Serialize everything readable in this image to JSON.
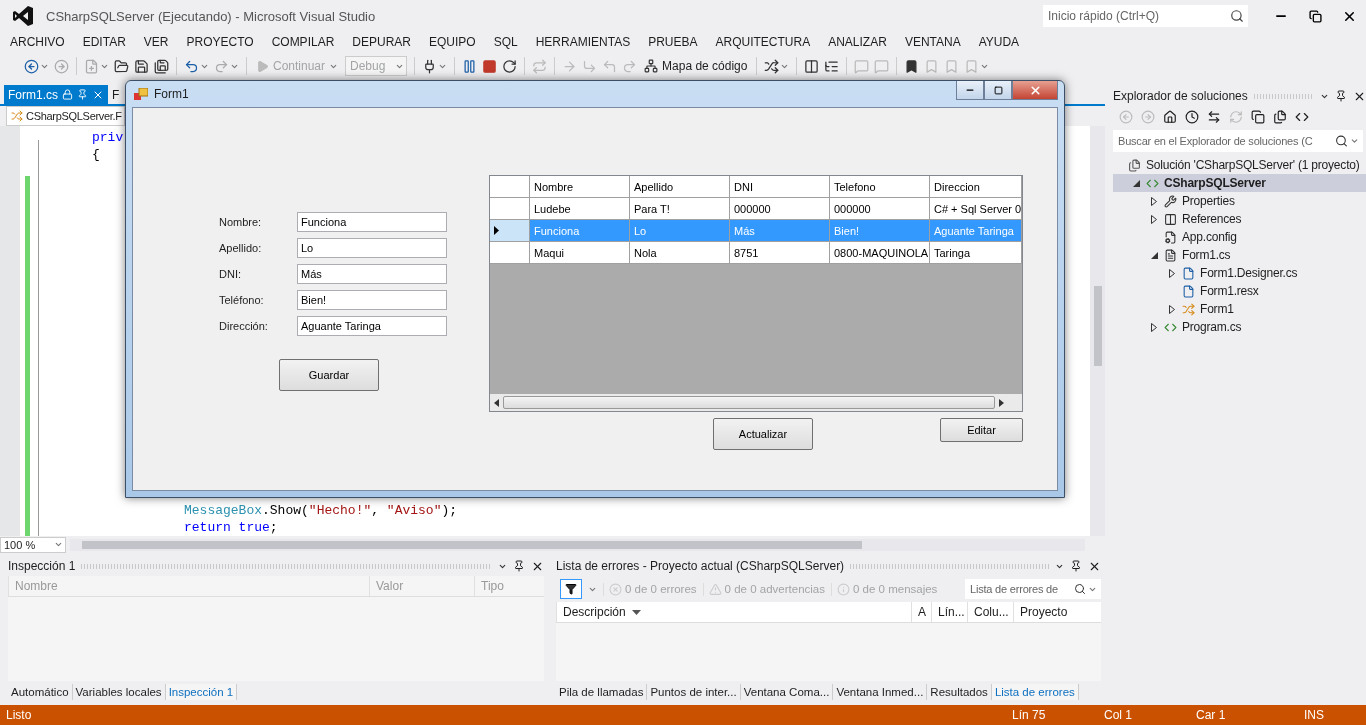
{
  "window": {
    "title": "CSharpSQLServer (Ejecutando) - Microsoft Visual Studio"
  },
  "quick_launch": {
    "placeholder": "Inicio rápido (Ctrl+Q)"
  },
  "menu": [
    "ARCHIVO",
    "EDITAR",
    "VER",
    "PROYECTO",
    "COMPILAR",
    "DEPURAR",
    "EQUIPO",
    "SQL",
    "HERRAMIENTAS",
    "PRUEBA",
    "ARQUITECTURA",
    "ANALIZAR",
    "VENTANA",
    "AYUDA"
  ],
  "toolbar": {
    "continue": {
      "label": "Continuar",
      "disabled": true
    },
    "configuration": {
      "value": "Debug",
      "disabled": true
    },
    "code_map": {
      "label": "Mapa de código"
    }
  },
  "editor": {
    "tabs": [
      {
        "label": "Form1.cs",
        "selected": true
      },
      {
        "label": "F",
        "selected": false
      }
    ],
    "navigation": "CSharpSQLServer.F",
    "code_top": [
      [
        {
          "text": "priv",
          "kind": "keyword"
        }
      ],
      [
        {
          "text": "{",
          "kind": "plain"
        }
      ]
    ],
    "code_bottom": [
      [
        {
          "text": "MessageBox",
          "kind": "type"
        },
        {
          "text": ".Show(",
          "kind": "plain"
        },
        {
          "text": "\"Hecho!\"",
          "kind": "string"
        },
        {
          "text": ", ",
          "kind": "plain"
        },
        {
          "text": "\"Aviso\"",
          "kind": "string"
        },
        {
          "text": ");",
          "kind": "plain"
        }
      ],
      [
        {
          "text": "return true",
          "kind": "keyword"
        },
        {
          "text": ";",
          "kind": "plain"
        }
      ]
    ],
    "zoom": "100 %"
  },
  "form": {
    "title": "Form1",
    "fields": [
      {
        "label": "Nombre:",
        "value": "Funciona"
      },
      {
        "label": "Apellido:",
        "value": "Lo"
      },
      {
        "label": "DNI:",
        "value": "Más"
      },
      {
        "label": "Teléfono:",
        "value": "Bien!"
      },
      {
        "label": "Dirección:",
        "value": "Aguante Taringa"
      }
    ],
    "save_button": "Guardar",
    "grid": {
      "columns": [
        "Nombre",
        "Apellido",
        "DNI",
        "Telefono",
        "Direccion"
      ],
      "rows": [
        {
          "selected": false,
          "cells": [
            "Ludebe",
            "Para T!",
            "000000",
            "000000",
            "C# + Sql Server 0"
          ]
        },
        {
          "selected": true,
          "cells": [
            "Funciona",
            "Lo",
            "Más",
            "Bien!",
            "Aguante Taringa"
          ]
        },
        {
          "selected": false,
          "cells": [
            "Maqui",
            "Nola",
            "8751",
            "0800-MAQUINOLA",
            "Taringa"
          ]
        }
      ]
    },
    "refresh_button": "Actualizar",
    "edit_button": "Editar"
  },
  "solution_explorer": {
    "title": "Explorador de soluciones",
    "search": {
      "placeholder": "Buscar en el Explorador de soluciones (C"
    },
    "tree": [
      {
        "label": "Solución 'CSharpSQLServer'  (1 proyecto)",
        "kind": "solution",
        "selected": false,
        "children": [
          {
            "label": "CSharpSQLServer",
            "kind": "project",
            "expanded": true,
            "selected": true,
            "children": [
              {
                "label": "Properties",
                "kind": "properties",
                "expanded": false,
                "selected": false
              },
              {
                "label": "References",
                "kind": "references",
                "expanded": false,
                "selected": false
              },
              {
                "label": "App.config",
                "kind": "config",
                "selected": false
              },
              {
                "label": "Form1.cs",
                "kind": "form",
                "expanded": true,
                "selected": false,
                "children": [
                  {
                    "label": "Form1.Designer.cs",
                    "kind": "file",
                    "expanded": false,
                    "selected": false
                  },
                  {
                    "label": "Form1.resx",
                    "kind": "file",
                    "selected": false
                  },
                  {
                    "label": "Form1",
                    "kind": "class",
                    "expanded": false,
                    "selected": false
                  }
                ]
              },
              {
                "label": "Program.cs",
                "kind": "csharp",
                "expanded": false,
                "selected": false
              }
            ]
          }
        ]
      }
    ]
  },
  "watch": {
    "title": "Inspección 1",
    "columns": [
      "Nombre",
      "Valor",
      "Tipo"
    ],
    "tabs": [
      {
        "label": "Automático",
        "selected": false
      },
      {
        "label": "Variables locales",
        "selected": false
      },
      {
        "label": "Inspección 1",
        "selected": true
      }
    ]
  },
  "error_list": {
    "title": "Lista de errores - Proyecto actual (CSharpSQLServer)",
    "filters": [
      {
        "label": "0 de 0 errores",
        "kind": "error"
      },
      {
        "label": "0 de 0 advertencias",
        "kind": "warning"
      },
      {
        "label": "0 de 0 mensajes",
        "kind": "message"
      }
    ],
    "search": {
      "placeholder": "Lista de errores de"
    },
    "columns": [
      "Descripción",
      "A",
      "Lín...",
      "Colu...",
      "Proyecto"
    ],
    "tabs": [
      {
        "label": "Pila de llamadas",
        "selected": false
      },
      {
        "label": "Puntos de inter...",
        "selected": false
      },
      {
        "label": "Ventana Coma...",
        "selected": false
      },
      {
        "label": "Ventana Inmed...",
        "selected": false
      },
      {
        "label": "Resultados",
        "selected": false
      },
      {
        "label": "Lista de errores",
        "selected": true
      }
    ]
  },
  "status_bar": {
    "message": "Listo",
    "line": "Lín 75",
    "column": "Col 1",
    "char": "Car 1",
    "mode": "INS"
  }
}
